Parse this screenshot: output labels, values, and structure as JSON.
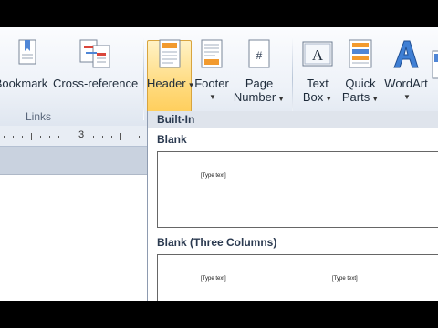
{
  "ribbon": {
    "links_group": {
      "label": "Links",
      "bookmark": "Bookmark",
      "cross_reference": "Cross-reference"
    },
    "header_footer_group": {
      "header": "Header",
      "footer": "Footer",
      "page_number_line1": "Page",
      "page_number_line2": "Number"
    },
    "text_group": {
      "text_box_line1": "Text",
      "text_box_line2": "Box",
      "quick_parts_line1": "Quick",
      "quick_parts_line2": "Parts",
      "wordart": "WordArt"
    }
  },
  "ruler": {
    "number": "3"
  },
  "header_gallery": {
    "section": "Built-In",
    "items": [
      {
        "title": "Blank",
        "placeholders": [
          "[Type text]"
        ]
      },
      {
        "title": "Blank (Three Columns)",
        "placeholders": [
          "[Type text]",
          "[Type text]"
        ]
      }
    ]
  },
  "colors": {
    "active_button": "#ffd97a",
    "ribbon_bg": "#eef2f8",
    "accent_icon": "#f29a2e"
  }
}
